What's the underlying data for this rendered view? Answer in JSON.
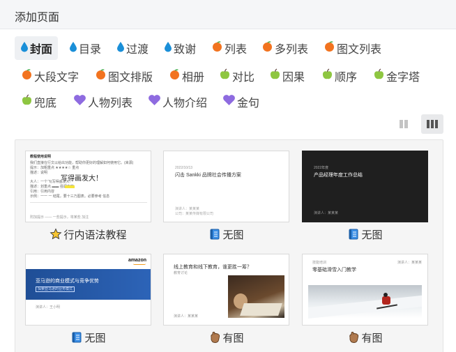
{
  "header": {
    "title": "添加页面"
  },
  "tags": [
    {
      "label": "封面",
      "icon": "droplet-icon",
      "active": true
    },
    {
      "label": "目录",
      "icon": "droplet-icon"
    },
    {
      "label": "过渡",
      "icon": "droplet-icon"
    },
    {
      "label": "致谢",
      "icon": "droplet-icon"
    },
    {
      "label": "列表",
      "icon": "orange-icon"
    },
    {
      "label": "多列表",
      "icon": "orange-icon"
    },
    {
      "label": "图文列表",
      "icon": "orange-icon"
    },
    {
      "label": "大段文字",
      "icon": "orange-icon"
    },
    {
      "label": "图文排版",
      "icon": "orange-icon"
    },
    {
      "label": "相册",
      "icon": "orange-icon"
    },
    {
      "label": "对比",
      "icon": "apple-icon"
    },
    {
      "label": "因果",
      "icon": "apple-icon"
    },
    {
      "label": "顺序",
      "icon": "apple-icon"
    },
    {
      "label": "金字塔",
      "icon": "apple-icon"
    },
    {
      "label": "兜底",
      "icon": "apple-icon"
    },
    {
      "label": "人物列表",
      "icon": "heart-icon"
    },
    {
      "label": "人物介绍",
      "icon": "heart-icon"
    },
    {
      "label": "金句",
      "icon": "heart-icon"
    }
  ],
  "cards": [
    {
      "label": "行内语法教程",
      "icon": "star-icon",
      "thumb": {
        "title": "教程使用说明",
        "lines": [
          "我们直接在行文以给出功能，帮助你更好的理解如何使用它。(来源)",
          "提示：加粗重点 ★★★★☆ 重点",
          "描述：说明",
          "大人：一个飞(写得画发大！",
          "描述：划重点 ▬▬ 强调内容",
          "引用：引用内容",
          "示例：一一 一 结尾，要十三乃图表。必要参考 信息",
          "附加提示 —— 一些提示，将某些 加注"
        ],
        "big": "写得画发大！"
      }
    },
    {
      "label": "无图",
      "icon": "book-icon",
      "thumb": {
        "date": "2022/10/13",
        "title": "闪击 Sankki 品牌社会传播方案",
        "foot1": "演讲人：某某某",
        "foot2": "公司：某某传媒有限公司"
      }
    },
    {
      "label": "无图",
      "icon": "book-icon",
      "thumb": {
        "date": "2022年度",
        "title": "产品经理年度工作总结",
        "foot1": "演讲人：某某某"
      }
    },
    {
      "label": "无图",
      "icon": "book-icon",
      "thumb": {
        "brand": "amazon",
        "title": "亚马逊的商业模式与竞争优势",
        "subtitle": "探索亚马逊的业务模式",
        "foot1": "演讲人：王小明"
      }
    },
    {
      "label": "有图",
      "icon": "hand-icon",
      "thumb": {
        "title": "线上教育和线下教育，谁更胜一筹？",
        "subtitle": "教育讨论",
        "foot1": "演讲人：某某某"
      }
    },
    {
      "label": "有图",
      "icon": "hand-icon",
      "thumb": {
        "top": "技能培训",
        "title": "零基础滑雪入门教学",
        "right": "演讲人：某某某"
      }
    }
  ],
  "colors": {
    "droplet": "#1a8fd8",
    "orange": "#f2731f",
    "apple": "#8ec641",
    "heart": "#8e6be0"
  }
}
